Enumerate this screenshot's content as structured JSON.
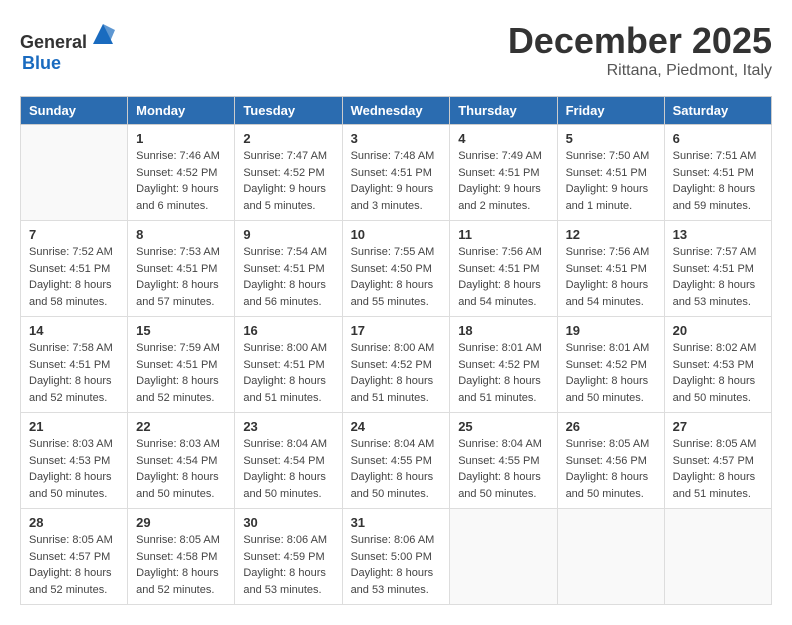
{
  "header": {
    "logo_general": "General",
    "logo_blue": "Blue",
    "month": "December 2025",
    "location": "Rittana, Piedmont, Italy"
  },
  "calendar": {
    "weekdays": [
      "Sunday",
      "Monday",
      "Tuesday",
      "Wednesday",
      "Thursday",
      "Friday",
      "Saturday"
    ],
    "weeks": [
      [
        {
          "day": "",
          "sunrise": "",
          "sunset": "",
          "daylight": ""
        },
        {
          "day": "1",
          "sunrise": "Sunrise: 7:46 AM",
          "sunset": "Sunset: 4:52 PM",
          "daylight": "Daylight: 9 hours and 6 minutes."
        },
        {
          "day": "2",
          "sunrise": "Sunrise: 7:47 AM",
          "sunset": "Sunset: 4:52 PM",
          "daylight": "Daylight: 9 hours and 5 minutes."
        },
        {
          "day": "3",
          "sunrise": "Sunrise: 7:48 AM",
          "sunset": "Sunset: 4:51 PM",
          "daylight": "Daylight: 9 hours and 3 minutes."
        },
        {
          "day": "4",
          "sunrise": "Sunrise: 7:49 AM",
          "sunset": "Sunset: 4:51 PM",
          "daylight": "Daylight: 9 hours and 2 minutes."
        },
        {
          "day": "5",
          "sunrise": "Sunrise: 7:50 AM",
          "sunset": "Sunset: 4:51 PM",
          "daylight": "Daylight: 9 hours and 1 minute."
        },
        {
          "day": "6",
          "sunrise": "Sunrise: 7:51 AM",
          "sunset": "Sunset: 4:51 PM",
          "daylight": "Daylight: 8 hours and 59 minutes."
        }
      ],
      [
        {
          "day": "7",
          "sunrise": "Sunrise: 7:52 AM",
          "sunset": "Sunset: 4:51 PM",
          "daylight": "Daylight: 8 hours and 58 minutes."
        },
        {
          "day": "8",
          "sunrise": "Sunrise: 7:53 AM",
          "sunset": "Sunset: 4:51 PM",
          "daylight": "Daylight: 8 hours and 57 minutes."
        },
        {
          "day": "9",
          "sunrise": "Sunrise: 7:54 AM",
          "sunset": "Sunset: 4:51 PM",
          "daylight": "Daylight: 8 hours and 56 minutes."
        },
        {
          "day": "10",
          "sunrise": "Sunrise: 7:55 AM",
          "sunset": "Sunset: 4:50 PM",
          "daylight": "Daylight: 8 hours and 55 minutes."
        },
        {
          "day": "11",
          "sunrise": "Sunrise: 7:56 AM",
          "sunset": "Sunset: 4:51 PM",
          "daylight": "Daylight: 8 hours and 54 minutes."
        },
        {
          "day": "12",
          "sunrise": "Sunrise: 7:56 AM",
          "sunset": "Sunset: 4:51 PM",
          "daylight": "Daylight: 8 hours and 54 minutes."
        },
        {
          "day": "13",
          "sunrise": "Sunrise: 7:57 AM",
          "sunset": "Sunset: 4:51 PM",
          "daylight": "Daylight: 8 hours and 53 minutes."
        }
      ],
      [
        {
          "day": "14",
          "sunrise": "Sunrise: 7:58 AM",
          "sunset": "Sunset: 4:51 PM",
          "daylight": "Daylight: 8 hours and 52 minutes."
        },
        {
          "day": "15",
          "sunrise": "Sunrise: 7:59 AM",
          "sunset": "Sunset: 4:51 PM",
          "daylight": "Daylight: 8 hours and 52 minutes."
        },
        {
          "day": "16",
          "sunrise": "Sunrise: 8:00 AM",
          "sunset": "Sunset: 4:51 PM",
          "daylight": "Daylight: 8 hours and 51 minutes."
        },
        {
          "day": "17",
          "sunrise": "Sunrise: 8:00 AM",
          "sunset": "Sunset: 4:52 PM",
          "daylight": "Daylight: 8 hours and 51 minutes."
        },
        {
          "day": "18",
          "sunrise": "Sunrise: 8:01 AM",
          "sunset": "Sunset: 4:52 PM",
          "daylight": "Daylight: 8 hours and 51 minutes."
        },
        {
          "day": "19",
          "sunrise": "Sunrise: 8:01 AM",
          "sunset": "Sunset: 4:52 PM",
          "daylight": "Daylight: 8 hours and 50 minutes."
        },
        {
          "day": "20",
          "sunrise": "Sunrise: 8:02 AM",
          "sunset": "Sunset: 4:53 PM",
          "daylight": "Daylight: 8 hours and 50 minutes."
        }
      ],
      [
        {
          "day": "21",
          "sunrise": "Sunrise: 8:03 AM",
          "sunset": "Sunset: 4:53 PM",
          "daylight": "Daylight: 8 hours and 50 minutes."
        },
        {
          "day": "22",
          "sunrise": "Sunrise: 8:03 AM",
          "sunset": "Sunset: 4:54 PM",
          "daylight": "Daylight: 8 hours and 50 minutes."
        },
        {
          "day": "23",
          "sunrise": "Sunrise: 8:04 AM",
          "sunset": "Sunset: 4:54 PM",
          "daylight": "Daylight: 8 hours and 50 minutes."
        },
        {
          "day": "24",
          "sunrise": "Sunrise: 8:04 AM",
          "sunset": "Sunset: 4:55 PM",
          "daylight": "Daylight: 8 hours and 50 minutes."
        },
        {
          "day": "25",
          "sunrise": "Sunrise: 8:04 AM",
          "sunset": "Sunset: 4:55 PM",
          "daylight": "Daylight: 8 hours and 50 minutes."
        },
        {
          "day": "26",
          "sunrise": "Sunrise: 8:05 AM",
          "sunset": "Sunset: 4:56 PM",
          "daylight": "Daylight: 8 hours and 50 minutes."
        },
        {
          "day": "27",
          "sunrise": "Sunrise: 8:05 AM",
          "sunset": "Sunset: 4:57 PM",
          "daylight": "Daylight: 8 hours and 51 minutes."
        }
      ],
      [
        {
          "day": "28",
          "sunrise": "Sunrise: 8:05 AM",
          "sunset": "Sunset: 4:57 PM",
          "daylight": "Daylight: 8 hours and 52 minutes."
        },
        {
          "day": "29",
          "sunrise": "Sunrise: 8:05 AM",
          "sunset": "Sunset: 4:58 PM",
          "daylight": "Daylight: 8 hours and 52 minutes."
        },
        {
          "day": "30",
          "sunrise": "Sunrise: 8:06 AM",
          "sunset": "Sunset: 4:59 PM",
          "daylight": "Daylight: 8 hours and 53 minutes."
        },
        {
          "day": "31",
          "sunrise": "Sunrise: 8:06 AM",
          "sunset": "Sunset: 5:00 PM",
          "daylight": "Daylight: 8 hours and 53 minutes."
        },
        {
          "day": "",
          "sunrise": "",
          "sunset": "",
          "daylight": ""
        },
        {
          "day": "",
          "sunrise": "",
          "sunset": "",
          "daylight": ""
        },
        {
          "day": "",
          "sunrise": "",
          "sunset": "",
          "daylight": ""
        }
      ]
    ]
  }
}
